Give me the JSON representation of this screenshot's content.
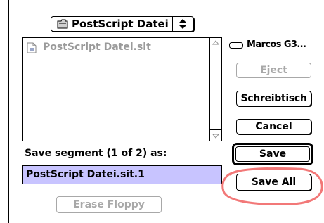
{
  "location_popup": {
    "label": "PostScript Datei",
    "icon": "folder-icon"
  },
  "file_list": {
    "items": [
      {
        "name": "PostScript Datei.sit",
        "icon": "document-icon"
      }
    ]
  },
  "disk": {
    "name": "Marcos G3...",
    "icon": "hard-disk-icon"
  },
  "buttons": {
    "eject": "Eject",
    "desktop": "Schreibtisch",
    "cancel": "Cancel",
    "save": "Save",
    "save_all": "Save All",
    "erase_floppy": "Erase Floppy"
  },
  "save_prompt": "Save segment (1 of 2) as:",
  "filename_value": "PostScript Datei.sit.1",
  "colors": {
    "selection": "#c8c4ff",
    "disabled": "#a8a8a8",
    "highlight_stroke": "#f06060"
  }
}
